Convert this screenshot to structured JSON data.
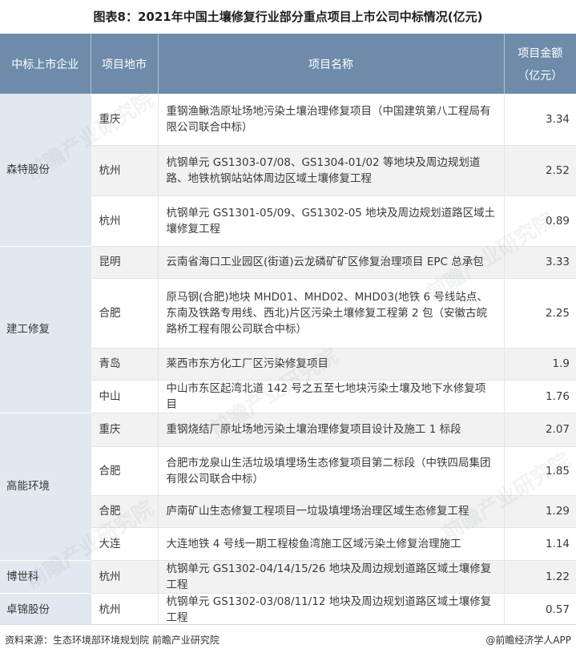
{
  "watermark": "前瞻产业研究院",
  "colors": {
    "header_bg": "#6e8caa",
    "company_bg": "#e1e8f0",
    "row_alt_bg": "#f2f2f2",
    "text": "#333333"
  },
  "chart_data": {
    "type": "table",
    "title": "图表8：2021年中国土壤修复行业部分重点项目上市公司中标情况(亿元)",
    "columns": [
      {
        "label": "中标上市企业"
      },
      {
        "label": "项目地市"
      },
      {
        "label": "项目名称"
      },
      {
        "label": "项目金额",
        "sub": "（亿元）"
      }
    ],
    "groups": [
      {
        "company": "森特股份",
        "rows": [
          {
            "city": "重庆",
            "project": "重钢渔鳅浩原址场地污染土壤治理修复项目（中国建筑第八工程局有限公司联合中标）",
            "amount": 3.34
          },
          {
            "city": "杭州",
            "project": "杭钢单元 GS1303-07/08、GS1304-01/02 等地块及周边规划道路、地铁杭钢站站体周边区域土壤修复工程",
            "amount": 2.52
          },
          {
            "city": "杭州",
            "project": "杭钢单元 GS1301-05/09、GS1302-05 地块及周边规划道路区域土壤修复工程",
            "amount": 0.89
          }
        ]
      },
      {
        "company": "建工修复",
        "rows": [
          {
            "city": "昆明",
            "project": "云南省海口工业园区(街道)云龙磷矿矿区修复治理项目 EPC 总承包",
            "amount": 3.33
          },
          {
            "city": "合肥",
            "project": "原马钢(合肥)地块 MHD01、MHD02、MHD03(地铁 6 号线站点、东南及铁路专用线、西北)片区污染土壤修复工程第 2 包（安徽古皖路桥工程有限公司联合中标）",
            "amount": 2.25
          },
          {
            "city": "青岛",
            "project": "莱西市东方化工厂区污染修复项目",
            "amount": 1.9
          },
          {
            "city": "中山",
            "project": "中山市东区起湾北道 142 号之五至七地块污染土壤及地下水修复项目",
            "amount": 1.76
          }
        ]
      },
      {
        "company": "高能环境",
        "rows": [
          {
            "city": "重庆",
            "project": "重钢烧结厂原址场地污染土壤治理修复项目设计及施工 1 标段",
            "amount": 2.07
          },
          {
            "city": "合肥",
            "project": "合肥市龙泉山生活垃圾填埋场生态修复项目第二标段（中铁四局集团有限公司联合中标）",
            "amount": 1.85
          },
          {
            "city": "合肥",
            "project": "庐南矿山生态修复工程项目一垃圾填埋场治理区域生态修复工程",
            "amount": 1.29
          },
          {
            "city": "大连",
            "project": "大连地铁 4 号线一期工程梭鱼湾施工区域污染土修复治理施工",
            "amount": 1.14
          }
        ]
      },
      {
        "company": "博世科",
        "rows": [
          {
            "city": "杭州",
            "project": "杭钢单元 GS1302-04/14/15/26 地块及周边规划道路区域土壤修复工程",
            "amount": 1.22
          }
        ]
      },
      {
        "company": "卓锦股份",
        "rows": [
          {
            "city": "杭州",
            "project": "杭钢单元 GS1302-03/08/11/12 地块及周边规划道路区域土壤修复工程",
            "amount": 0.57
          }
        ]
      }
    ]
  },
  "footer": {
    "source": "资料来源：生态环境部环境规划院 前瞻产业研究院",
    "brand": "@前瞻经济学人APP"
  }
}
